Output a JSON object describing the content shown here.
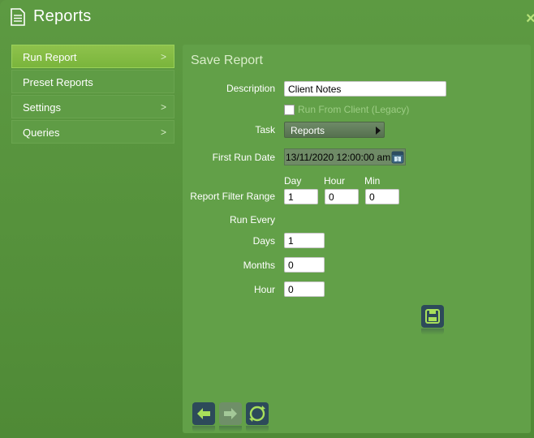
{
  "window": {
    "title": "Reports",
    "close_glyph": "×",
    "icon": "document-icon"
  },
  "sidebar": {
    "items": [
      {
        "label": "Run Report",
        "chevron": ">",
        "active": true
      },
      {
        "label": "Preset Reports",
        "chevron": "",
        "active": false
      },
      {
        "label": "Settings",
        "chevron": ">",
        "active": false
      },
      {
        "label": "Queries",
        "chevron": ">",
        "active": false
      }
    ]
  },
  "form": {
    "title": "Save Report",
    "description": {
      "label": "Description",
      "value": "Client Notes"
    },
    "run_from_client": {
      "label": "Run From Client (Legacy)",
      "checked": false
    },
    "task": {
      "label": "Task",
      "value": "Reports"
    },
    "first_run_date": {
      "label": "First Run Date",
      "value": "13/11/2020 12:00:00 am"
    },
    "filter_range": {
      "label": "Report Filter Range",
      "day_label": "Day",
      "hour_label": "Hour",
      "min_label": "Min",
      "day": "1",
      "hour": "0",
      "min": "0"
    },
    "run_every": {
      "label": "Run Every",
      "days_label": "Days",
      "days": "1",
      "months_label": "Months",
      "months": "0",
      "hour_label": "Hour",
      "hour": "0"
    }
  },
  "colors": {
    "background": "#5a9440",
    "panel": "#62a048",
    "active_item": "#8ec24c",
    "button_dark": "#2d4a5a"
  },
  "icons": {
    "save": "save-icon",
    "back": "arrow-left-icon",
    "forward": "arrow-right-icon",
    "refresh": "refresh-icon",
    "calendar": "calendar-icon"
  }
}
